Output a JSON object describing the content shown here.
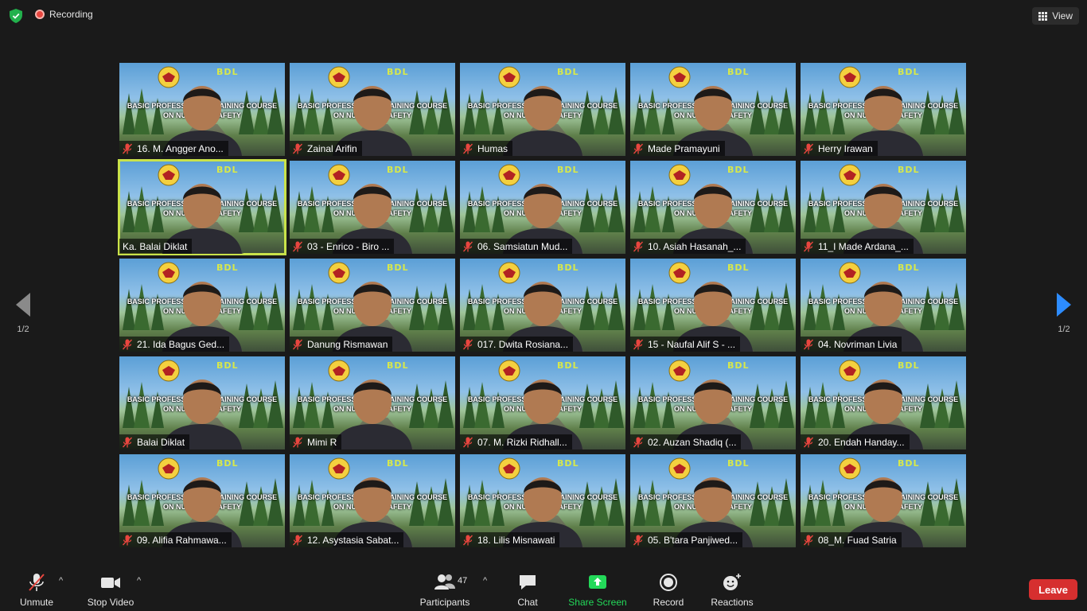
{
  "top_bar": {
    "recording_label": "Recording",
    "view_label": "View"
  },
  "banner_text": "BASIC PROFESSIONAL TRAINING COURSE ON NUCLEAR SAFETY",
  "brand_mark": "BDL",
  "participants": [
    {
      "name": "16. M. Angger Ano...",
      "muted": true
    },
    {
      "name": "Zainal Arifin",
      "muted": true
    },
    {
      "name": "Humas",
      "muted": true
    },
    {
      "name": "Made Pramayuni",
      "muted": true
    },
    {
      "name": "Herry Irawan",
      "muted": true
    },
    {
      "name": "Ka. Balai Diklat",
      "muted": false,
      "active": true
    },
    {
      "name": "03 - Enrico - Biro ...",
      "muted": true
    },
    {
      "name": "06. Samsiatun Mud...",
      "muted": true
    },
    {
      "name": "10. Asiah Hasanah_...",
      "muted": true
    },
    {
      "name": "11_I Made Ardana_...",
      "muted": true
    },
    {
      "name": "21. Ida Bagus Ged...",
      "muted": true
    },
    {
      "name": "Danung Rismawan",
      "muted": true
    },
    {
      "name": "017. Dwita Rosiana...",
      "muted": true
    },
    {
      "name": "15 - Naufal Alif S - ...",
      "muted": true
    },
    {
      "name": "04. Novriman Livia",
      "muted": true
    },
    {
      "name": "Balai Diklat",
      "muted": true
    },
    {
      "name": "Mimi R",
      "muted": true
    },
    {
      "name": "07. M. Rizki Ridhall...",
      "muted": true
    },
    {
      "name": "02. Auzan Shadiq (...",
      "muted": true
    },
    {
      "name": "20. Endah Handay...",
      "muted": true
    },
    {
      "name": "09. Alifia Rahmawa...",
      "muted": true
    },
    {
      "name": "12. Asystasia Sabat...",
      "muted": true
    },
    {
      "name": "18. Lilis Misnawati",
      "muted": true
    },
    {
      "name": "05. B'tara Panjiwed...",
      "muted": true
    },
    {
      "name": "08_M. Fuad Satria",
      "muted": true
    }
  ],
  "page_nav": {
    "left_page": "1/2",
    "right_page": "1/2"
  },
  "toolbar": {
    "unmute_label": "Unmute",
    "stop_video_label": "Stop Video",
    "participants_label": "Participants",
    "participants_count": "47",
    "chat_label": "Chat",
    "share_screen_label": "Share Screen",
    "record_label": "Record",
    "reactions_label": "Reactions",
    "leave_label": "Leave"
  },
  "colors": {
    "active_speaker": "#c9e24a",
    "share_screen": "#23d959",
    "leave": "#d62f2f",
    "muted_icon": "#e8463f"
  }
}
